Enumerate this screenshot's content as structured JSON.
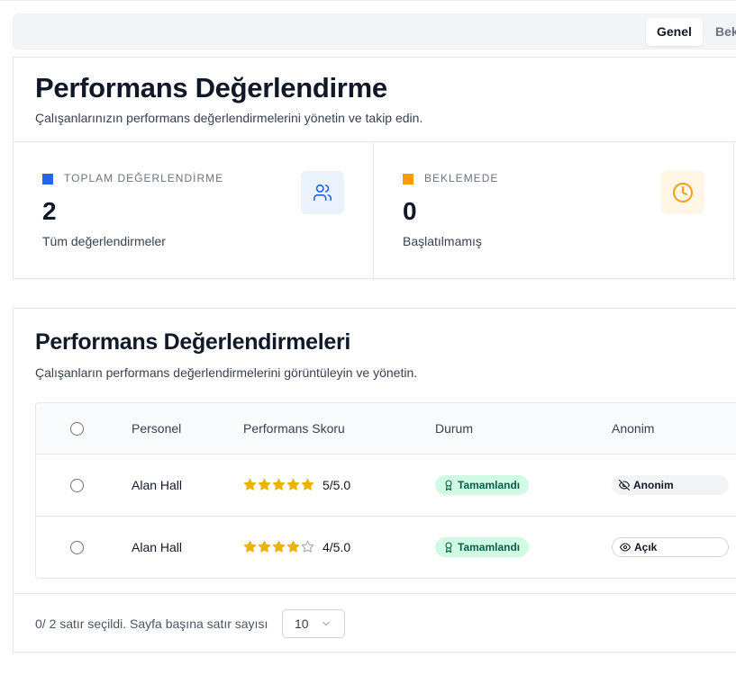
{
  "tabs": [
    {
      "label": "Genel",
      "active": true
    },
    {
      "label": "Bek",
      "active": false
    }
  ],
  "summary": {
    "title": "Performans Değerlendirme",
    "subtitle": "Çalışanlarınızın performans değerlendirmelerini yönetin ve takip edin.",
    "stats": [
      {
        "label": "TOPLAM DEĞERLENDİRME",
        "value": "2",
        "description": "Tüm değerlendirmeler",
        "color": "#2563eb",
        "icon": "users-icon"
      },
      {
        "label": "BEKLEMEDE",
        "value": "0",
        "description": "Başlatılmamış",
        "color": "#f59e0b",
        "icon": "clock-icon"
      }
    ]
  },
  "table_card": {
    "title": "Performans Değerlendirmeleri",
    "subtitle": "Çalışanların performans değerlendirmelerini görüntüleyin ve yönetin.",
    "columns": [
      "Personel",
      "Performans Skoru",
      "Durum",
      "Anonim"
    ],
    "rows": [
      {
        "name": "Alan Hall",
        "stars": 5,
        "score": "5/5.0",
        "status": "Tamamlandı",
        "anon": "Anonim",
        "anon_icon": "eye-off-icon"
      },
      {
        "name": "Alan Hall",
        "stars": 4,
        "score": "4/5.0",
        "status": "Tamamlandı",
        "anon": "Açık",
        "anon_icon": "eye-icon"
      }
    ],
    "footer": {
      "selection_text": "0/ 2 satır seçildi. Sayfa başına satır sayısı",
      "page_size": "10"
    }
  },
  "colors": {
    "star_filled": "#eab308",
    "star_empty": "#9ca3af",
    "status_bg": "#d1fae5",
    "status_text": "#065f46",
    "blue": "#2563eb",
    "orange": "#f59e0b"
  }
}
